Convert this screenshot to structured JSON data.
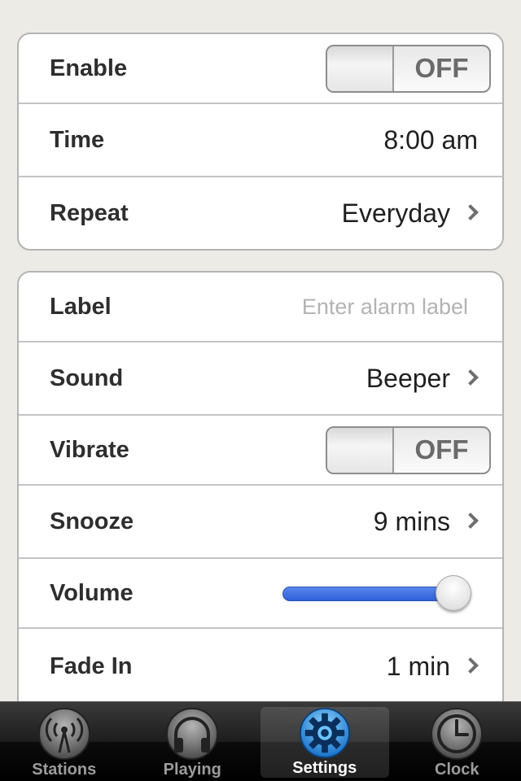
{
  "alarm": {
    "enable": {
      "label": "Enable",
      "state": "OFF"
    },
    "time": {
      "label": "Time",
      "value": "8:00 am"
    },
    "repeat": {
      "label": "Repeat",
      "value": "Everyday"
    }
  },
  "details": {
    "label": {
      "label": "Label",
      "placeholder": "Enter alarm label"
    },
    "sound": {
      "label": "Sound",
      "value": "Beeper"
    },
    "vibrate": {
      "label": "Vibrate",
      "state": "OFF"
    },
    "snooze": {
      "label": "Snooze",
      "value": "9 mins"
    },
    "volume": {
      "label": "Volume",
      "level": 1.0
    },
    "fade_in": {
      "label": "Fade In",
      "value": "1 min"
    }
  },
  "tabbar": {
    "tabs": [
      {
        "label": "Stations",
        "icon": "broadcast-icon",
        "active": false
      },
      {
        "label": "Playing",
        "icon": "headphones-icon",
        "active": false
      },
      {
        "label": "Settings",
        "icon": "gear-icon",
        "active": true
      },
      {
        "label": "Clock",
        "icon": "clock-icon",
        "active": false
      }
    ]
  },
  "colors": {
    "accent": "#3b6fe0",
    "background": "#ecebe6"
  }
}
